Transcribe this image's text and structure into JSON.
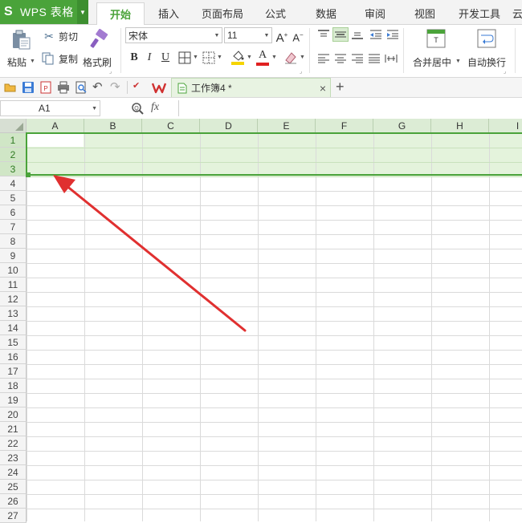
{
  "app": {
    "logo": "S",
    "name": "WPS 表格"
  },
  "menu_tabs": [
    "开始",
    "插入",
    "页面布局",
    "公式",
    "数据",
    "审阅",
    "视图",
    "开发工具",
    "云"
  ],
  "active_tab": "开始",
  "ribbon": {
    "paste": "粘贴",
    "cut": "剪切",
    "copy": "复制",
    "format_painter": "格式刷",
    "font_name": "宋体",
    "font_size": "11",
    "bold": "B",
    "italic": "I",
    "underline": "U",
    "merge_center": "合并居中",
    "auto_wrap": "自动换行"
  },
  "document_tab": {
    "title": "工作簿4 *",
    "close": "×",
    "new_tab": "+"
  },
  "formula_bar": {
    "name_box": "A1",
    "fx": "fx",
    "content": ""
  },
  "columns": [
    "A",
    "B",
    "C",
    "D",
    "E",
    "F",
    "G",
    "H",
    "I"
  ],
  "rows": [
    "1",
    "2",
    "3",
    "4",
    "5",
    "6",
    "7",
    "8",
    "9",
    "10",
    "11",
    "12",
    "13",
    "14",
    "15",
    "16",
    "17",
    "18",
    "19",
    "20",
    "21",
    "22",
    "23",
    "24",
    "25",
    "26",
    "27"
  ],
  "selected_rows": [
    "1",
    "2",
    "3"
  ],
  "active_cell": "A1",
  "colors": {
    "accent": "#4aa33a",
    "selection_fill": "#e4f3dc",
    "arrow": "#e03030"
  }
}
